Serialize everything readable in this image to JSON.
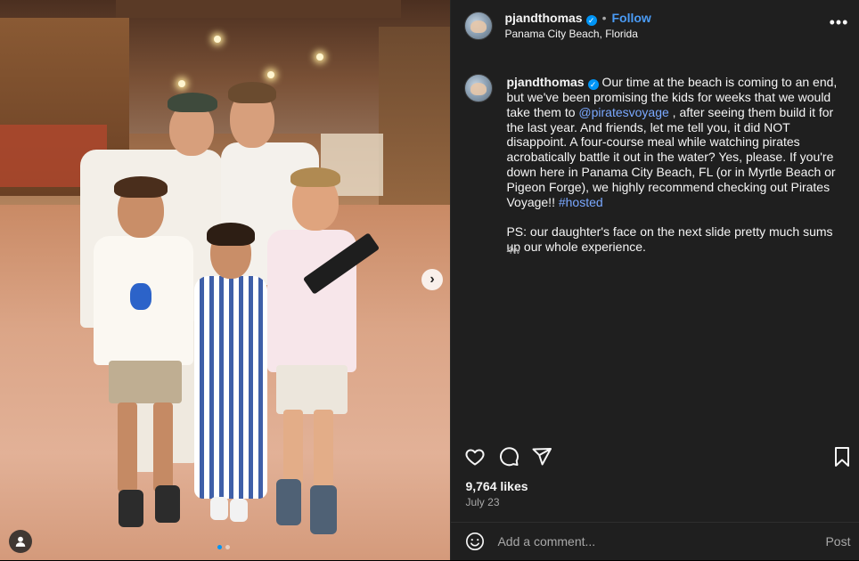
{
  "post": {
    "username": "pjandthomas",
    "follow_label": "Follow",
    "separator": "•",
    "location": "Panama City Beach, Florida",
    "more_label": "•••",
    "verified_icon": "verified-badge-icon"
  },
  "caption": {
    "username": "pjandthomas",
    "text_1": " Our time at the beach is coming to an end, but we've been promising the kids for weeks that we would take them to ",
    "mention": "@piratesvoyage",
    "text_2": " , after seeing them build it for the last year. And friends, let me tell you, it did NOT disappoint. A four-course meal while watching pirates acrobatically battle it out in the water? Yes, please. If you're down here in Panama City Beach, FL (or in Myrtle Beach or Pigeon Forge), we highly recommend checking out Pirates Voyage!! ",
    "hashtag": "#hosted",
    "text_3": "\n\nPS: our daughter's face on the next slide pretty much sums up our whole experience.",
    "time_ago": "4w"
  },
  "stats": {
    "likes": "9,764 likes",
    "date": "July 23"
  },
  "comment_box": {
    "placeholder": "Add a comment...",
    "post_label": "Post"
  },
  "carousel": {
    "next_label": "›",
    "slide_count": 2,
    "active_slide": 1
  },
  "colors": {
    "accent": "#0095f6",
    "link": "#7aa8ff",
    "panel_bg": "#1f1f1f",
    "muted": "#a8a8a8"
  }
}
